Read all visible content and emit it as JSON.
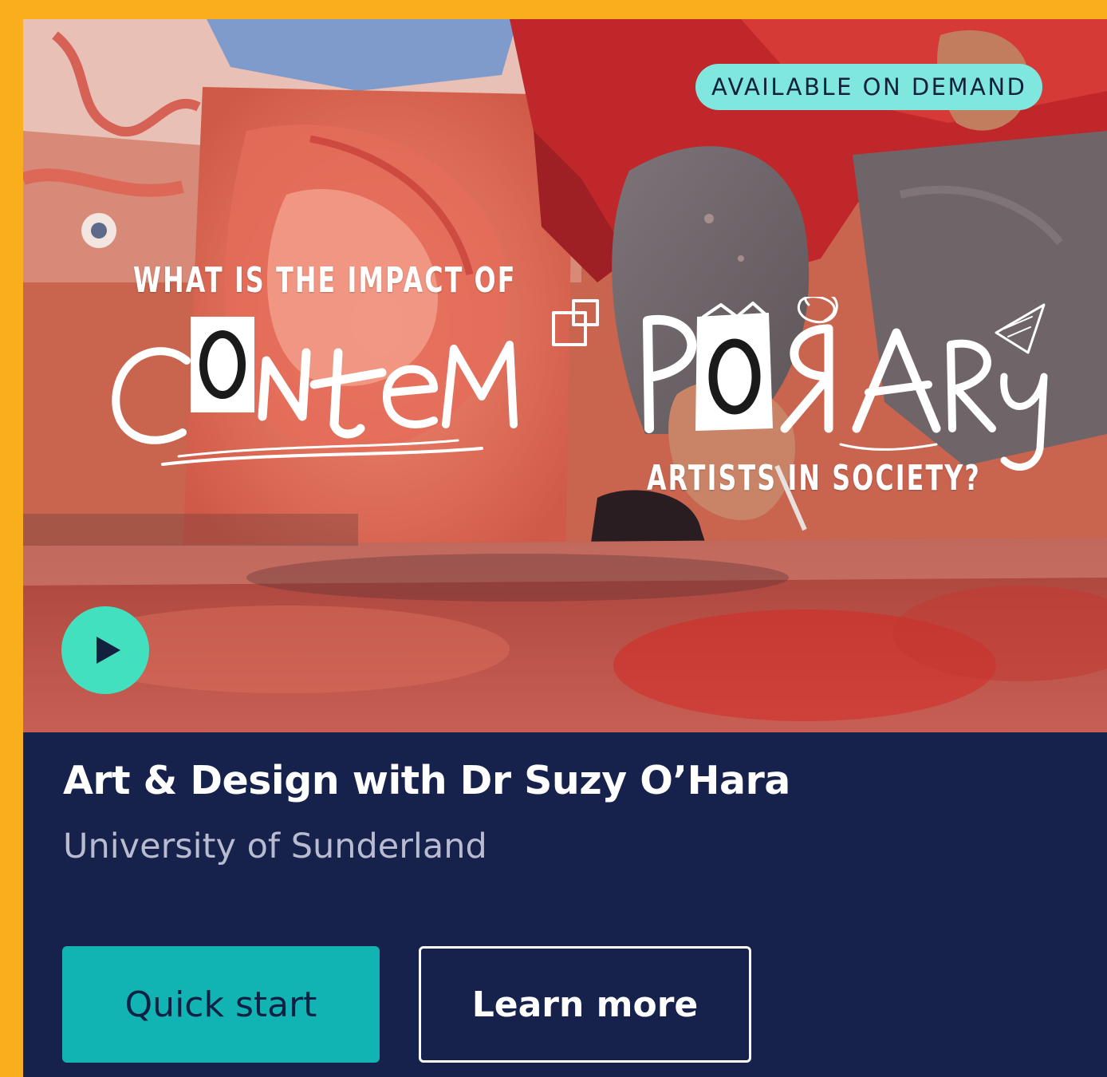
{
  "hero": {
    "badge": "AVAILABLE ON DEMAND",
    "headline_top": "WHAT IS THE IMPACT OF",
    "headline_main": "CONTEMPORARY",
    "headline_bottom": "ARTISTS IN SOCIETY?",
    "play_icon": "play-icon"
  },
  "card": {
    "title": "Art & Design with Dr Suzy O’Hara",
    "subtitle": "University of Sunderland"
  },
  "actions": {
    "quick_start_label": "Quick start",
    "learn_more_label": "Learn more"
  },
  "colors": {
    "page_background": "#F9AE1B",
    "card_background": "#16224B",
    "badge_background": "#7FE7DD",
    "play_button": "#43E0C0",
    "quick_start": "#12B3B3",
    "subtitle_text": "#B9BCD0"
  }
}
